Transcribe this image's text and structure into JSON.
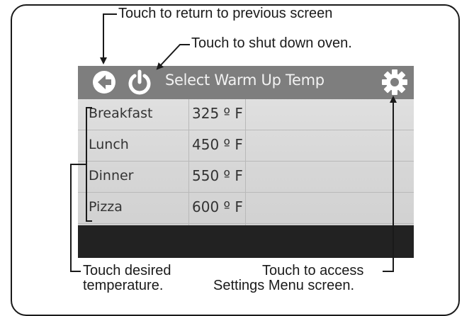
{
  "callouts": {
    "return": "Touch to return to previous screen",
    "shutdown": "Touch to shut down oven.",
    "desired_line1": "Touch desired",
    "desired_line2": "temperature.",
    "settings_line1": "Touch to access",
    "settings_line2": "Settings Menu screen."
  },
  "screen": {
    "title": "Select Warm Up Temp",
    "icons": {
      "back": "back-arrow-icon",
      "power": "power-icon",
      "settings": "gear-icon"
    },
    "rows": [
      {
        "name": "Breakfast",
        "temp": "325 º F"
      },
      {
        "name": "Lunch",
        "temp": "450 º F"
      },
      {
        "name": "Dinner",
        "temp": "550 º F"
      },
      {
        "name": "Pizza",
        "temp": "600 º F"
      }
    ],
    "colors": {
      "header": "#7e7e7e",
      "footer": "#222222",
      "text": "#333333"
    }
  }
}
